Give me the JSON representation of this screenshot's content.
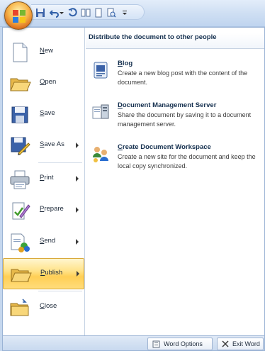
{
  "qat": {
    "icons": [
      "save-icon",
      "undo-icon",
      "redo-icon",
      "two-pages-icon",
      "blank-page-icon",
      "print-preview-icon",
      "customize-dropdown-icon"
    ]
  },
  "menu": {
    "items": [
      {
        "label": "New",
        "icon": "new-document-icon",
        "has_arrow": false
      },
      {
        "label": "Open",
        "icon": "open-folder-icon",
        "has_arrow": false
      },
      {
        "label": "Save",
        "icon": "save-icon",
        "has_arrow": false
      },
      {
        "label": "Save As",
        "icon": "save-as-icon",
        "has_arrow": true
      },
      {
        "label": "Print",
        "icon": "printer-icon",
        "has_arrow": true
      },
      {
        "label": "Prepare",
        "icon": "prepare-icon",
        "has_arrow": true
      },
      {
        "label": "Send",
        "icon": "send-icon",
        "has_arrow": true
      },
      {
        "label": "Publish",
        "icon": "publish-icon",
        "has_arrow": true,
        "active": true
      },
      {
        "label": "Close",
        "icon": "close-folder-icon",
        "has_arrow": false
      }
    ]
  },
  "publish_panel": {
    "header": "Distribute the document to other people",
    "items": [
      {
        "title": "Blog",
        "description": "Create a new blog post with the content of the document.",
        "icon": "blog-icon"
      },
      {
        "title": "Document Management Server",
        "description": "Share the document by saving it to a document management server.",
        "icon": "server-icon"
      },
      {
        "title": "Create Document Workspace",
        "description": "Create a new site for the document and keep the local copy synchronized.",
        "icon": "workspace-icon"
      }
    ]
  },
  "bottom": {
    "options_label": "Word Options",
    "exit_label": "Exit Word"
  },
  "colors": {
    "active_highlight": "#ffd86a",
    "header_text": "#15304f",
    "ribbon_blue": "#c5d7ee"
  }
}
